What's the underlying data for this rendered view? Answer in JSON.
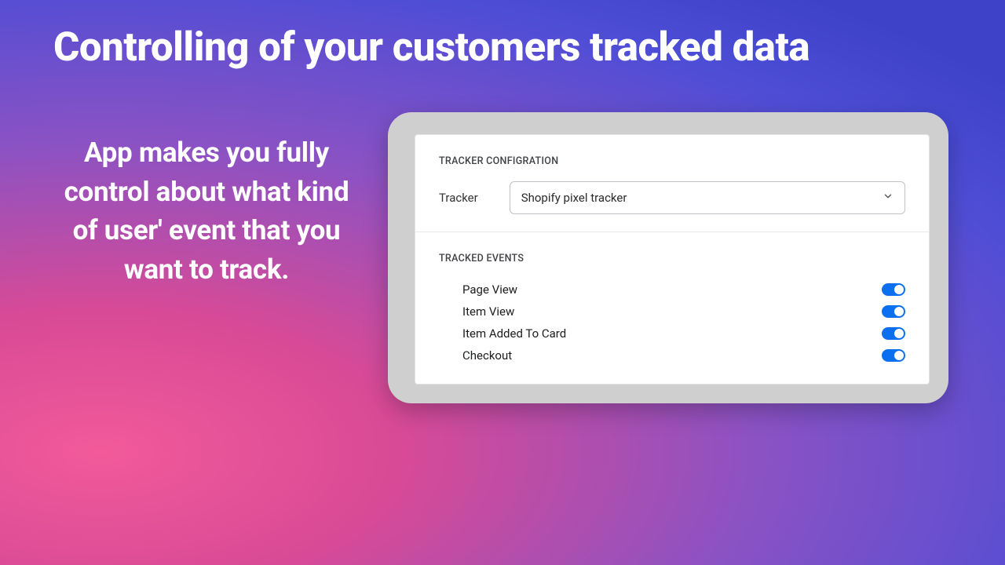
{
  "title": "Controlling of your customers tracked data",
  "subtitle": "App makes you fully control about what kind of user' event that you want to track.",
  "config": {
    "section_label": "TRACKER CONFIGRATION",
    "field_label": "Tracker",
    "selected": "Shopify pixel tracker"
  },
  "events": {
    "section_label": "TRACKED EVENTS",
    "items": [
      {
        "label": "Page View",
        "on": true
      },
      {
        "label": "Item View",
        "on": true
      },
      {
        "label": "Item Added To Card",
        "on": true
      },
      {
        "label": "Checkout",
        "on": true
      }
    ]
  }
}
